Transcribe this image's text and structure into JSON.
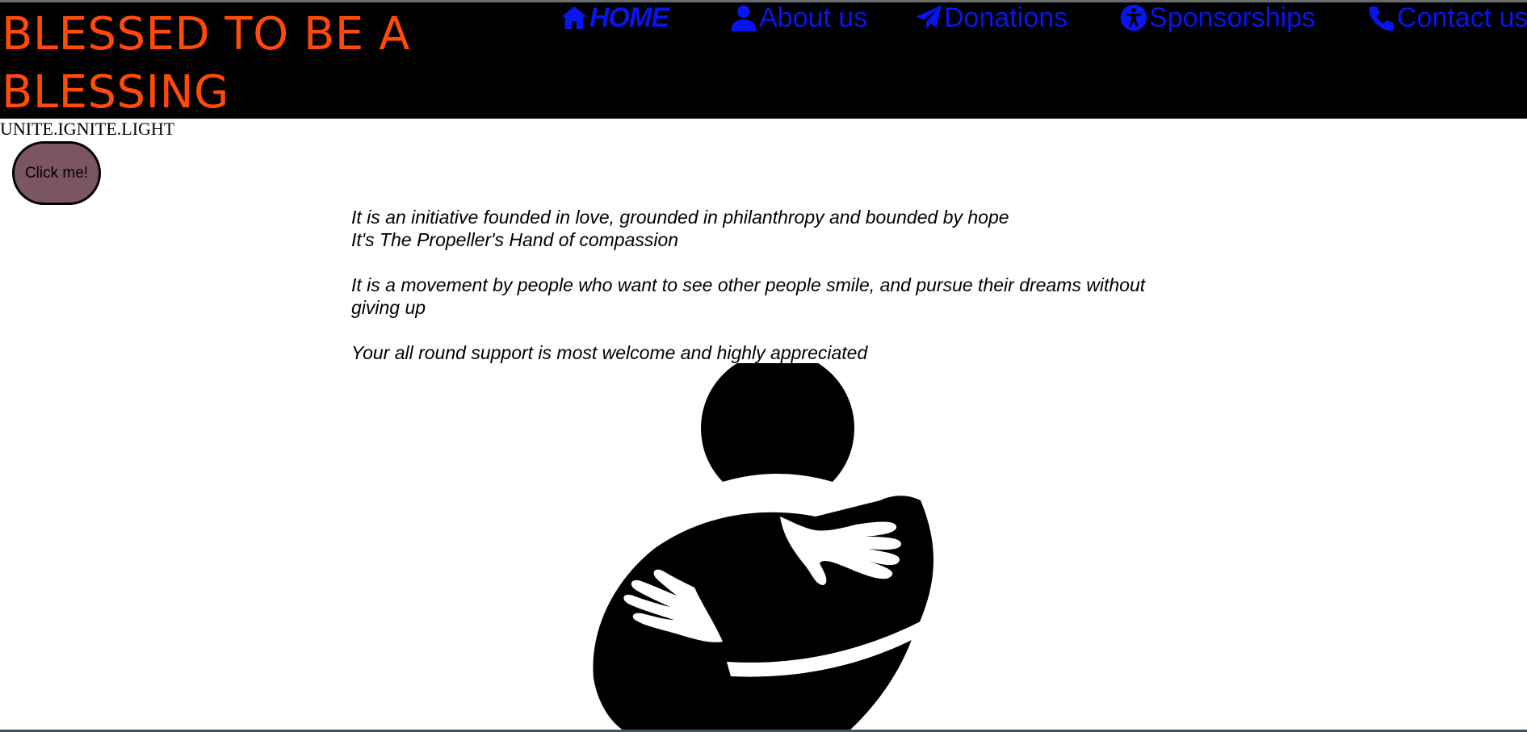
{
  "header": {
    "title": "BLESSED TO BE A BLESSING",
    "title_color": "#ff4a0a",
    "background": "#000000"
  },
  "nav": {
    "link_color": "#0a14ee",
    "items": [
      {
        "label": "HOME",
        "icon": "home-icon"
      },
      {
        "label": "About us",
        "icon": "user-icon"
      },
      {
        "label": "Donations",
        "icon": "paper-plane-icon"
      },
      {
        "label": "Sponsorships",
        "icon": "accessibility-icon"
      },
      {
        "label": "Contact us",
        "icon": "phone-icon"
      }
    ]
  },
  "tagline": "UNITE.IGNITE.LIGHT",
  "button": {
    "label": "Click me!",
    "color": "#7b5560"
  },
  "intro": {
    "line1": "It is an initiative founded in love, grounded in philanthropy and bounded by hope",
    "line2": "It's The Propeller's Hand of compassion",
    "line3": "It is a movement by people who want to see other people smile, and pursue their dreams without giving up",
    "line4": "Your all round support is most welcome and highly appreciated"
  },
  "logo": {
    "icon": "hug-logo-icon"
  }
}
